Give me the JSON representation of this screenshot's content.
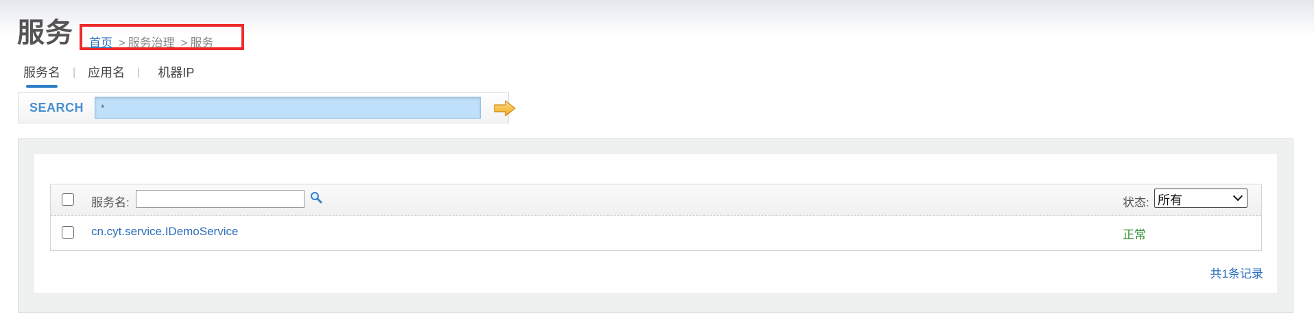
{
  "header": {
    "title": "服务",
    "breadcrumb": {
      "home": "首页",
      "sep1": ">",
      "section": "服务治理",
      "sep2": ">",
      "current": "服务"
    }
  },
  "tabs": [
    {
      "label": "服务名",
      "active": true
    },
    {
      "label": "应用名",
      "active": false
    },
    {
      "label": "机器IP",
      "active": false
    }
  ],
  "tab_separator": "|",
  "search": {
    "label": "SEARCH",
    "value": "*",
    "go_icon": "arrow-right-icon"
  },
  "table": {
    "filter_label": "服务名:",
    "filter_value": "",
    "filter_icon": "magnifier-icon",
    "status_label": "状态:",
    "status_selected": "所有",
    "rows": [
      {
        "service": "cn.cyt.service.IDemoService",
        "status": "正常"
      }
    ],
    "footer": "共1条记录"
  },
  "colors": {
    "link": "#2a6ebb",
    "status_ok": "#2e8b2e",
    "highlight_box": "#ee2a2a",
    "search_label": "#4a90d2",
    "search_field": "#bfe0fa"
  }
}
